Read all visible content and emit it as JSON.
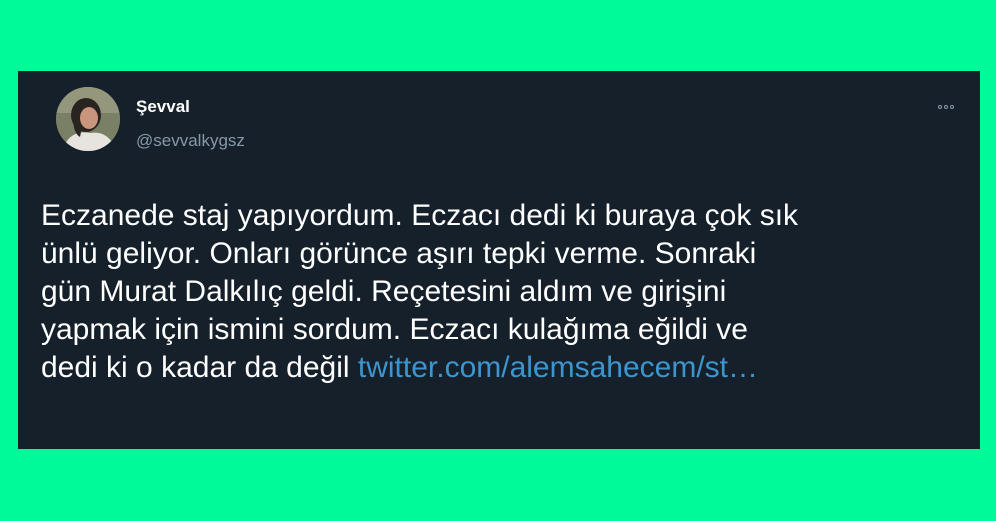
{
  "tweet": {
    "display_name": "Şevval",
    "handle": "@sevvalkygsz",
    "lines": [
      "Eczanede staj yapıyordum. Eczacı dedi ki buraya çok sık",
      "ünlü geliyor. Onları görünce aşırı tepki verme. Sonraki",
      "gün Murat Dalkılıç geldi. Reçetesini aldım ve girişini",
      "yapmak için ismini sordum. Eczacı kulağıma eğildi ve",
      "dedi ki o kadar da değil "
    ],
    "link_text": "twitter.com/alemsahecem/st…"
  },
  "icons": {
    "avatar": "profile-photo",
    "more": "more-options-icon"
  },
  "colors": {
    "page_background": "#00fa9a",
    "card_background": "#15202b",
    "text": "#ffffff",
    "secondary_text": "#8899a6",
    "link": "#3d95ce"
  }
}
